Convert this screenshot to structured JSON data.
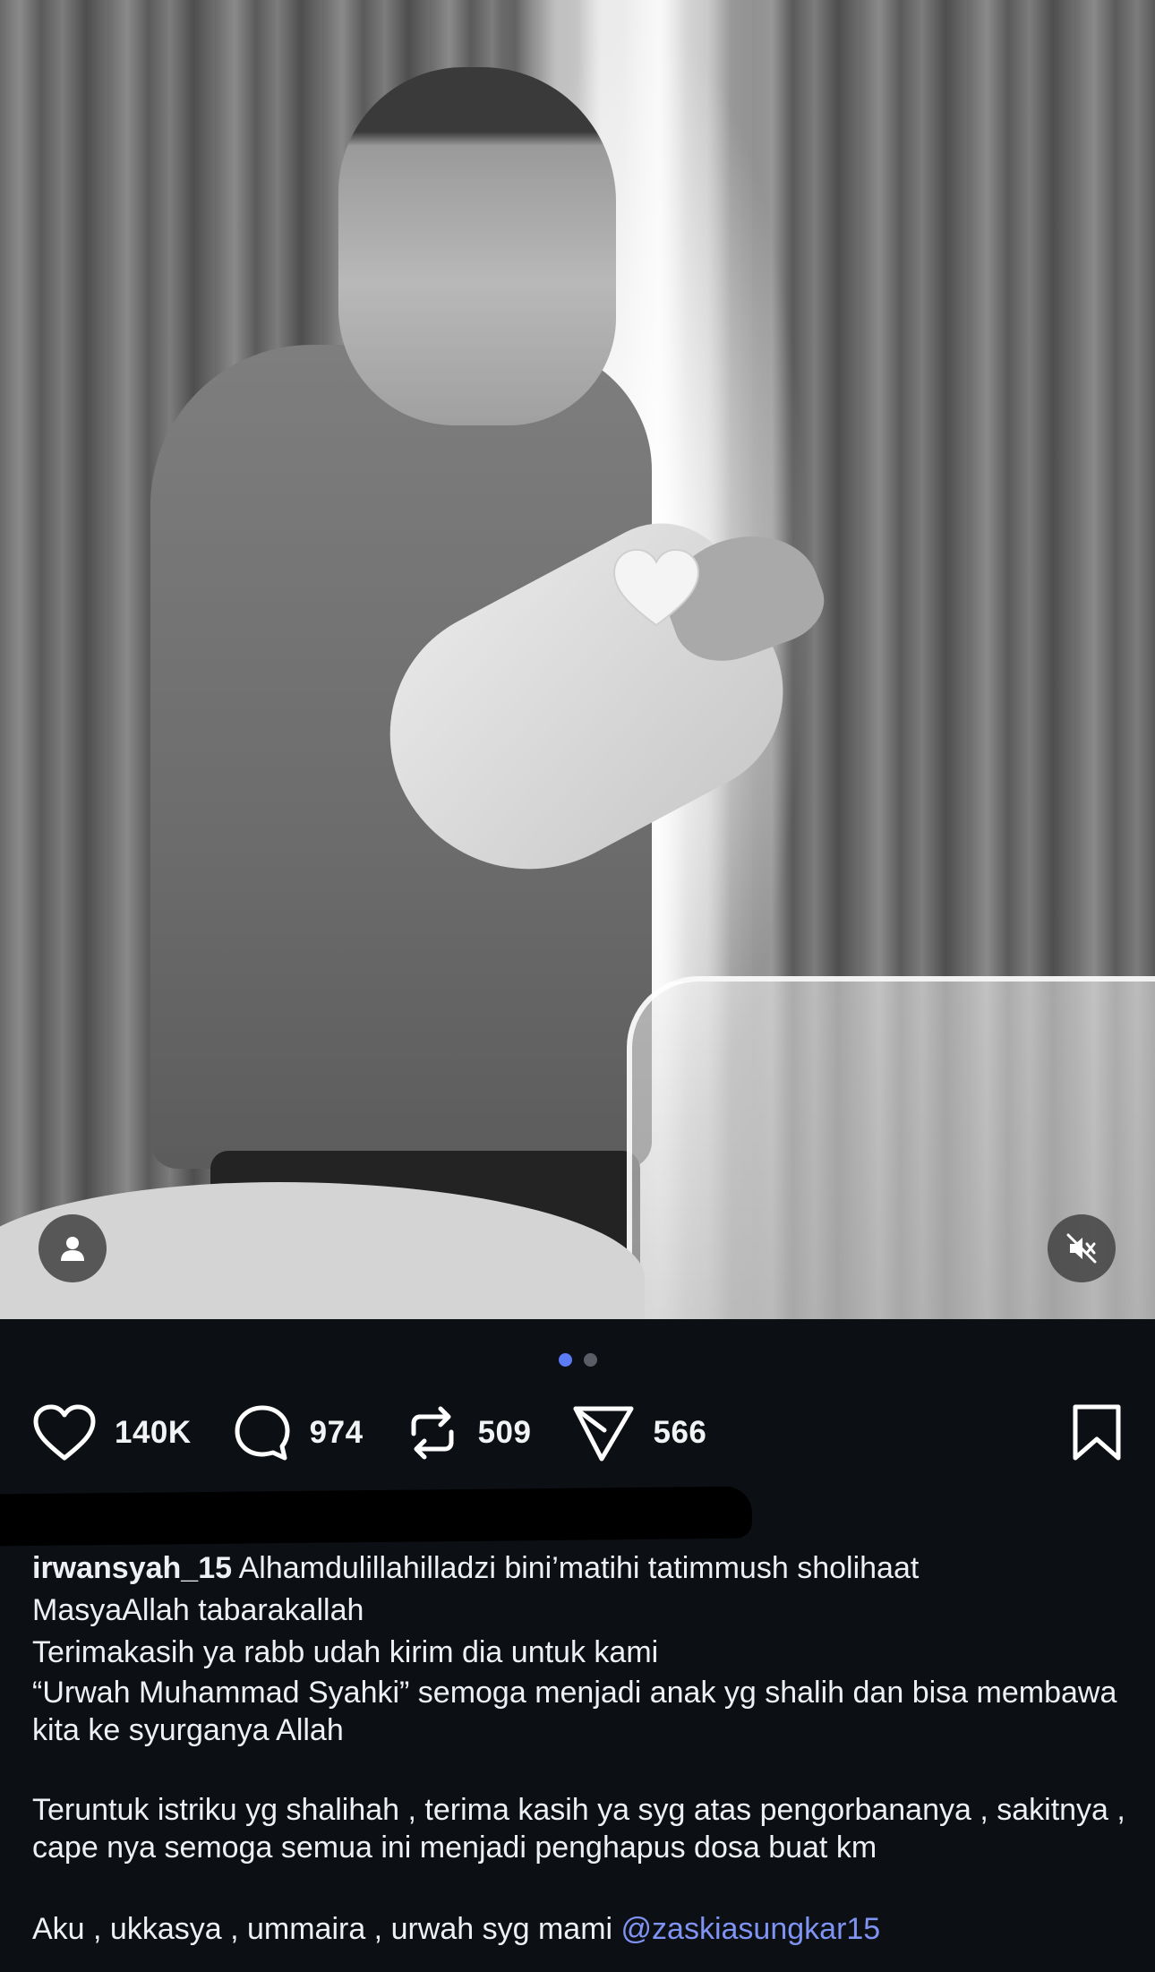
{
  "post": {
    "media_index": 1,
    "media_count": 2
  },
  "actions": {
    "likes": "140K",
    "comments": "974",
    "reposts": "509",
    "shares": "566"
  },
  "icons": {
    "like": "heart-icon",
    "comment": "comment-bubble-icon",
    "repost": "repost-icon",
    "share": "send-icon",
    "bookmark": "bookmark-icon",
    "user_tag": "person-icon",
    "mute": "speaker-muted-icon"
  },
  "colors": {
    "background": "#0c0f14",
    "text": "#f2f3f5",
    "mention": "#7f93f2",
    "active_dot": "#5b7cf5"
  },
  "caption": {
    "username": "irwansyah_15",
    "line1": "Alhamdulillahilladzi bini’matihi tatimmush sholihaat",
    "line2": "MasyaAllah tabarakallah",
    "line3": "Terimakasih ya rabb udah kirim dia untuk kami",
    "line4": "“Urwah Muhammad Syahki” semoga menjadi anak yg shalih dan bisa membawa kita ke syurganya Allah",
    "line5": "Teruntuk istriku yg shalihah , terima kasih ya syg atas pengorbananya , sakitnya , cape nya semoga semua ini menjadi penghapus dosa buat km",
    "line6_prefix": "Aku , ukkasya , ummaira , urwah syg mami",
    "mention": "@zaskiasungkar15"
  }
}
